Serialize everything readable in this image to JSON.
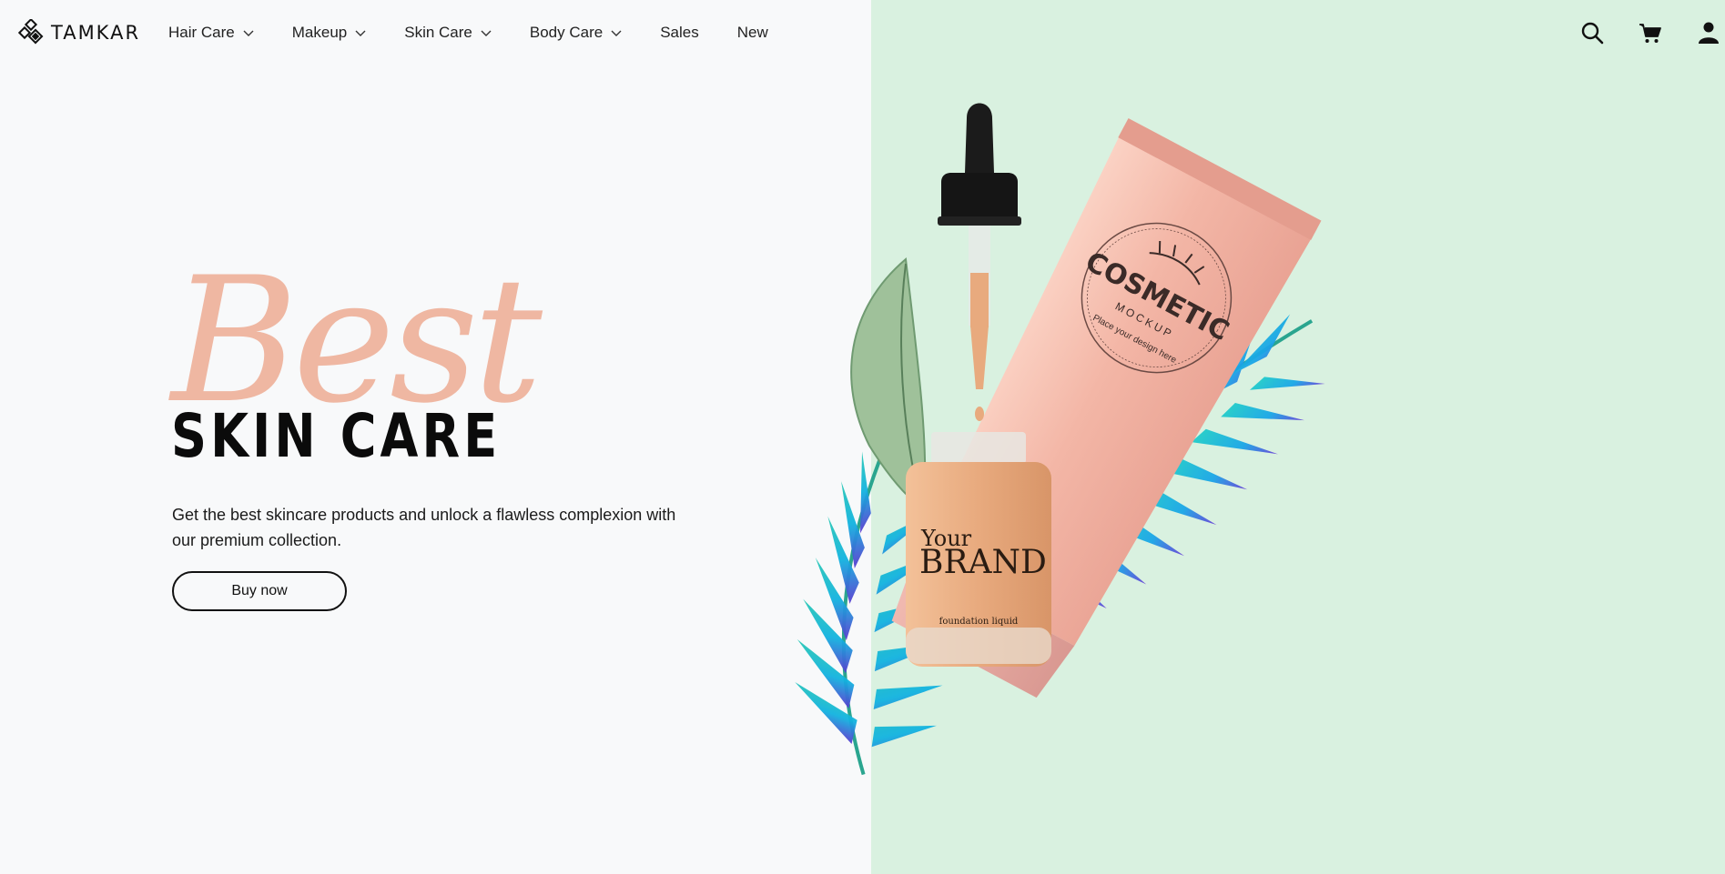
{
  "brand": {
    "name": "TAMKAR"
  },
  "nav": {
    "items": [
      {
        "label": "Hair Care",
        "has_dropdown": true
      },
      {
        "label": "Makeup",
        "has_dropdown": true
      },
      {
        "label": "Skin Care",
        "has_dropdown": true
      },
      {
        "label": "Body Care",
        "has_dropdown": true
      },
      {
        "label": "Sales",
        "has_dropdown": false
      },
      {
        "label": "New",
        "has_dropdown": false
      }
    ]
  },
  "header_icons": [
    "search-icon",
    "cart-icon",
    "user-icon"
  ],
  "hero": {
    "script_word": "Best",
    "title": "SKIN CARE",
    "description": "Get the best skincare products and unlock a flawless complexion with our premium collection.",
    "cta_label": "Buy now"
  },
  "product": {
    "tube_label_main": "COSMETIC",
    "tube_label_sub": "MOCKUP",
    "tube_label_curve": "Place your design here",
    "bottle_label_small": "Your",
    "bottle_label_big": "BRAND",
    "bottle_label_sub": "foundation liquid"
  },
  "colors": {
    "page_bg": "#f8f9fa",
    "panel_bg": "#d9f1e0",
    "script_accent": "#efb7a2",
    "tube_pink": "#f1b2a3",
    "bottle_orange": "#e8aa7e"
  }
}
